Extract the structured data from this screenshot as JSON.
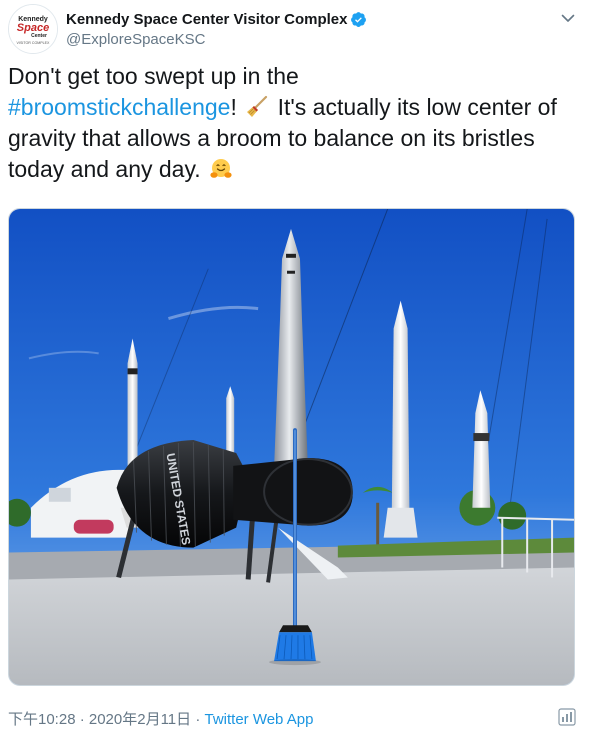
{
  "account": {
    "display_name": "Kennedy Space Center Visitor Complex",
    "handle": "@ExploreSpaceKSC",
    "verified": true,
    "avatar_text": [
      "Kennedy",
      "Space",
      "Center",
      "VISITOR COMPLEX"
    ]
  },
  "tweet": {
    "text_part1": "Don't get too swept up in the",
    "hashtag": "#broomstickchallenge",
    "text_part2": "!",
    "text_part3": "It's actually its low center of gravity that allows a broom to balance on its bristles today and any day.",
    "emoji_1": "broom-emoji",
    "emoji_2": "hugging-face-emoji"
  },
  "media": {
    "capsule_label": "UNITED STATES"
  },
  "footer": {
    "timestamp": "下午10:28 · 2020年2月11日 · ",
    "source": "Twitter Web App"
  },
  "icons": {
    "verified": "verified-badge-icon",
    "caret": "chevron-down-icon",
    "analytics": "analytics-icon"
  },
  "colors": {
    "link": "#1b95e0",
    "verified": "#1da1f2",
    "muted": "#657786",
    "sky": "#1d63c9"
  }
}
